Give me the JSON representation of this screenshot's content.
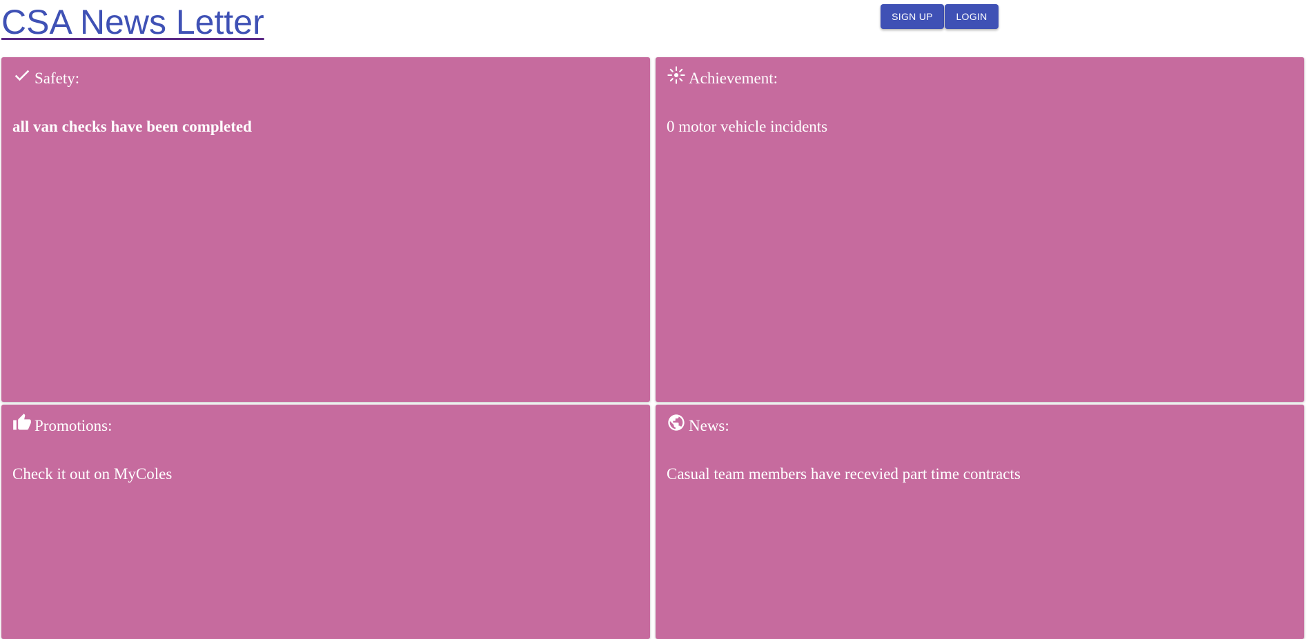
{
  "header": {
    "title": "CSA News Letter",
    "signup_label": "SIGN UP",
    "login_label": "LOGIN"
  },
  "cards": [
    {
      "title": "Safety:",
      "body": "all van checks have been completed",
      "icon": "check-icon"
    },
    {
      "title": "Achievement:",
      "body": "0 motor vehicle incidents",
      "icon": "sparkle-icon"
    },
    {
      "title": "Promotions:",
      "body": "Check it out on MyColes",
      "icon": "thumbs-up-icon"
    },
    {
      "title": "News:",
      "body": "Casual team members have recevied part time contracts",
      "icon": "globe-icon"
    }
  ],
  "colors": {
    "accent": "#3f51b5",
    "card_background": "#c66b9e",
    "card_text": "#ffffff"
  }
}
